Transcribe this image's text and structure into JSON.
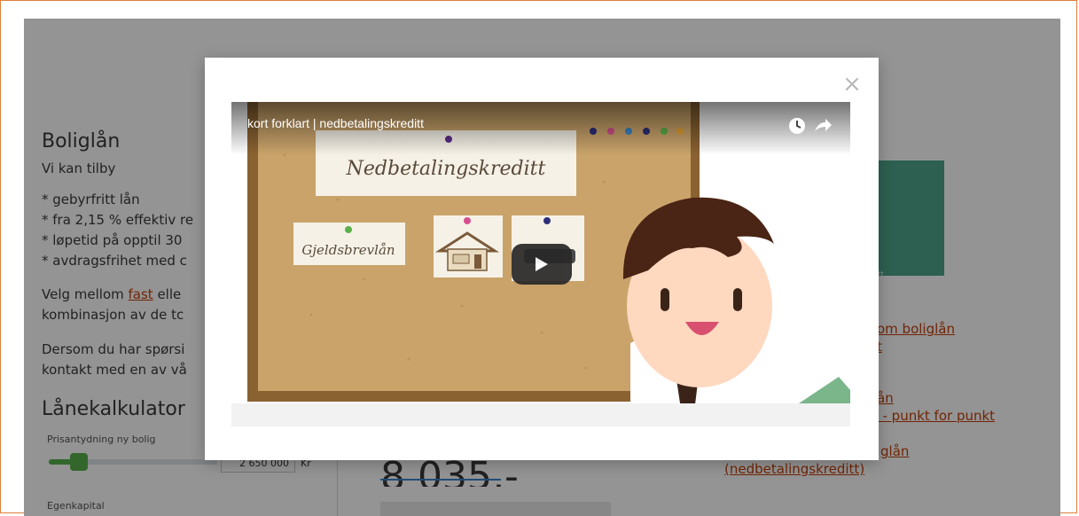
{
  "page": {
    "heading": "Boliglån",
    "intro": "Vi kan tilby",
    "bullets": [
      "* gebyrfritt lån",
      "* fra 2,15 %  effektiv re",
      "* løpetid på opptil 30",
      "* avdragsfrihet med c"
    ],
    "choose_prefix": "Velg mellom ",
    "choose_link": "fast",
    "choose_suffix": " elle",
    "choose_line2": "kombinasjon av de tc",
    "contact_line1": "Dersom du har spørsi",
    "contact_line2": "kontakt med en av vå"
  },
  "calculator": {
    "title": "Lånekalkulator",
    "price_label": "Prisantydning ny bolig",
    "price_value": "2 650 000",
    "currency": "Kr",
    "equity_label": "Egenkapital",
    "monthly_amount": "8 035,-",
    "slider_level": 0.18
  },
  "right": {
    "thumb_label": "gskreditt",
    "link1_line1": "om boliglån",
    "link1_line2": "t",
    "link2_line1": "ån",
    "link2_line2": "t) - punkt for punkt",
    "link3_line1": "glån",
    "link3_line2": "(nedbetalingskreditt)"
  },
  "modal": {
    "close_glyph": "×",
    "video_title": "kort forklart | nedbetalingskreditt",
    "board_heading": "Nedbetalingskreditt",
    "note_label": "Gjeldsbrevlån",
    "icons": [
      "close-icon",
      "clock-icon",
      "share-icon",
      "play-icon"
    ],
    "colors": {
      "board": "#c9a36a",
      "board_frame": "#8a6232",
      "play_button": "#282828",
      "overlay": "#6b6b6b",
      "accent_link": "#c2410c",
      "slider": "#56b04a"
    }
  }
}
